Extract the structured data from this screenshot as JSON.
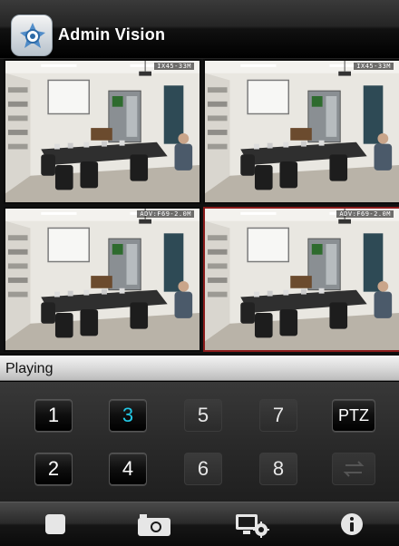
{
  "app": {
    "title": "Admin Vision",
    "logo_icon": "app-logo-icon"
  },
  "cameras": [
    {
      "osd": "IX45-33M",
      "selected": false
    },
    {
      "osd": "IX45-33M",
      "selected": false
    },
    {
      "osd": "ADV:F69-2.0M",
      "selected": false
    },
    {
      "osd": "ADV:F69-2.0M",
      "selected": true
    }
  ],
  "status": {
    "text": "Playing"
  },
  "channels": {
    "row1": [
      "1",
      "3",
      "5",
      "7",
      "PTZ"
    ],
    "row2": [
      "2",
      "4",
      "6",
      "8",
      ""
    ],
    "active_channel": "3",
    "active_color": "#22c8e6"
  },
  "toolbar": {
    "icons": [
      "stop-icon",
      "camera-snapshot-icon",
      "device-settings-icon",
      "info-icon"
    ]
  }
}
